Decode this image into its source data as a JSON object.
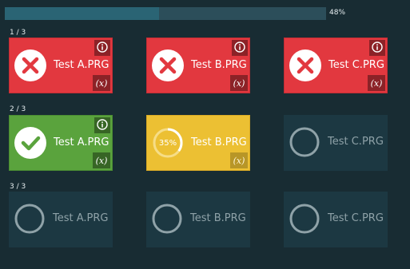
{
  "progress": {
    "percent_label": "48%",
    "fraction": 0.48
  },
  "rows": [
    {
      "label": "1 / 3",
      "tiles": [
        {
          "name": "Test A.PRG",
          "status": "failed",
          "has_info": true,
          "var_label": "(x)"
        },
        {
          "name": "Test B.PRG",
          "status": "failed",
          "has_info": true,
          "var_label": "(x)"
        },
        {
          "name": "Test C.PRG",
          "status": "failed",
          "has_info": true,
          "var_label": "(x)"
        }
      ]
    },
    {
      "label": "2 / 3",
      "tiles": [
        {
          "name": "Test A.PRG",
          "status": "passed",
          "has_info": true,
          "var_label": "(x)"
        },
        {
          "name": "Test B.PRG",
          "status": "running",
          "has_info": false,
          "var_label": "(x)",
          "progress_label": "35%",
          "progress": 0.35
        },
        {
          "name": "Test C.PRG",
          "status": "pending",
          "has_info": false,
          "var_label": ""
        }
      ]
    },
    {
      "label": "3 / 3",
      "tiles": [
        {
          "name": "Test A.PRG",
          "status": "pending",
          "has_info": false,
          "var_label": ""
        },
        {
          "name": "Test B.PRG",
          "status": "pending",
          "has_info": false,
          "var_label": ""
        },
        {
          "name": "Test C.PRG",
          "status": "pending",
          "has_info": false,
          "var_label": ""
        }
      ]
    }
  ],
  "icons": {
    "failed": "x-circle-icon",
    "passed": "check-circle-icon",
    "running": "progress-ring-icon",
    "pending": "empty-ring-icon",
    "info": "info-icon"
  },
  "colors": {
    "background": "#182c33",
    "failed": "#e2383f",
    "passed": "#5aa33d",
    "running": "#ecc033",
    "pending": "#1c3842",
    "progress_fill": "#2a6474",
    "progress_track": "#2c4e5a"
  }
}
